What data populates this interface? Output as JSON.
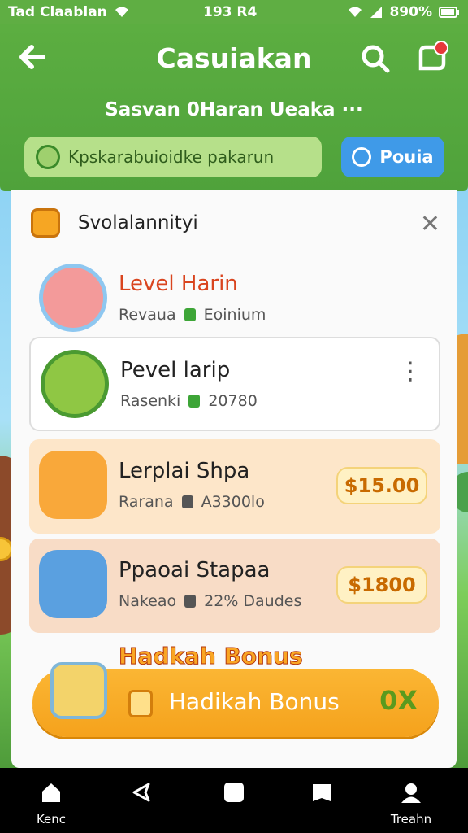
{
  "status_bar": {
    "carrier": "Tad Claablan",
    "time": "193 R4",
    "battery": "890%"
  },
  "header": {
    "title": "Casuiakan",
    "subtitle": "Sasvan 0Haran Ueaka ···",
    "promo_text": "Kpskarabuioidke pakarun",
    "action_button": "Pouia"
  },
  "panel": {
    "title": "Svolalannityi",
    "rows": [
      {
        "name": "Level Harin",
        "meta_left": "Revaua",
        "meta_right": "Eoinium"
      },
      {
        "name": "Pevel larip",
        "meta_left": "Rasenki",
        "meta_right": "20780"
      },
      {
        "name": "Lerplai Shpa",
        "meta_left": "Rarana",
        "meta_right": "A3300lo",
        "price": "$15.00"
      },
      {
        "name": "Ppaoai Stapaa",
        "meta_left": "Nakeao",
        "meta_right": "22% Daudes",
        "price": "$1800"
      }
    ],
    "bonus_title": "Hadkah Bonus",
    "bonus_button": "Hadikah Bonus",
    "bonus_value": "0X"
  },
  "nav": {
    "home_label": "Kenc",
    "team_label": "Treahn"
  },
  "colors": {
    "header_green": "#5cae41",
    "accent_orange": "#f5a21c",
    "link_blue": "#3f9ae8"
  }
}
